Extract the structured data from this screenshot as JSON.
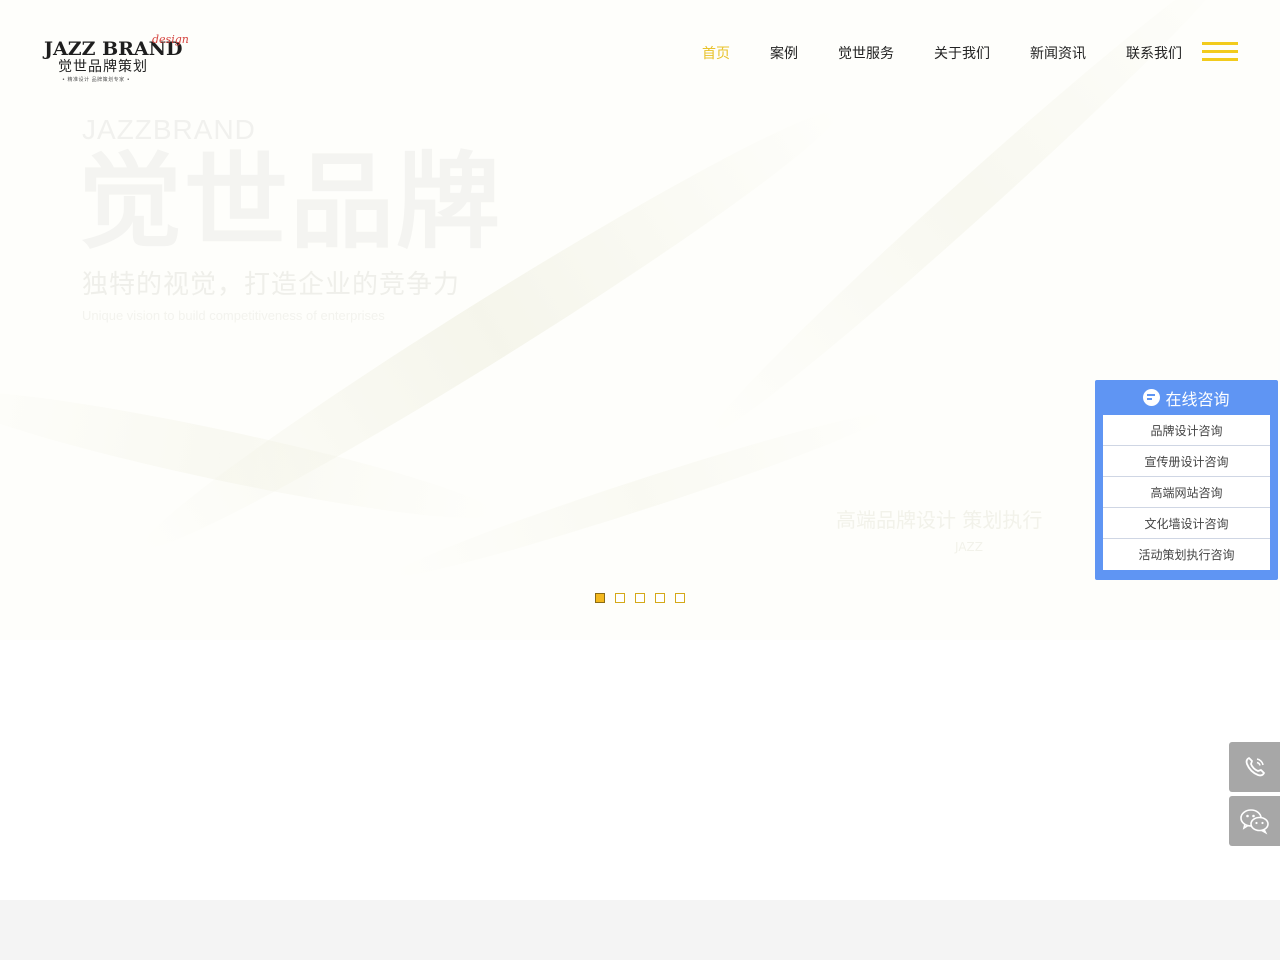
{
  "logo": {
    "en": "JAZZ BRAND",
    "design": "design",
    "cn": "觉世品牌策划",
    "tagline": "• 精准设计 品牌策划专家 •"
  },
  "nav": {
    "items": [
      {
        "label": "首页",
        "active": true
      },
      {
        "label": "案例",
        "active": false
      },
      {
        "label": "觉世服务",
        "active": false
      },
      {
        "label": "关于我们",
        "active": false
      },
      {
        "label": "新闻资讯",
        "active": false
      },
      {
        "label": "联系我们",
        "active": false
      }
    ],
    "active_color": "#e8c22a",
    "menu_icon": "hamburger-icon"
  },
  "hero": {
    "brand_en": "JAZZBRAND",
    "brand_cn": "觉世品牌",
    "subtitle_cn": "独特的视觉，打造企业的竞争力",
    "subtitle_en": "Unique vision to build competitiveness of enterprises",
    "right_text": "高端品牌设计 策划执行",
    "right_text_small": "JAZZ",
    "slides_total": 5,
    "slide_active": 1
  },
  "consult": {
    "title": "在线咨询",
    "icon": "chat-bubble-icon",
    "items": [
      "品牌设计咨询",
      "宣传册设计咨询",
      "高端网站咨询",
      "文化墙设计咨询",
      "活动策划执行咨询"
    ],
    "color": "#5f95f3"
  },
  "side_tools": {
    "phone_icon": "phone-icon",
    "wechat_icon": "wechat-icon"
  }
}
